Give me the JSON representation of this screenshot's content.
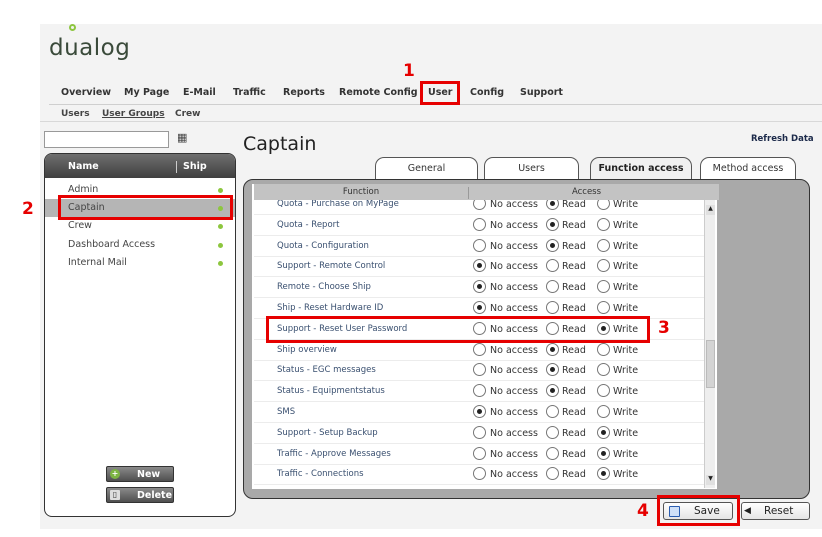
{
  "brand": {
    "logo_text": "dualog"
  },
  "top_nav": [
    {
      "label": "Overview"
    },
    {
      "label": "My Page"
    },
    {
      "label": "E-Mail"
    },
    {
      "label": "Traffic"
    },
    {
      "label": "Reports"
    },
    {
      "label": "Remote Config"
    },
    {
      "label": "User"
    },
    {
      "label": "Config"
    },
    {
      "label": "Support"
    }
  ],
  "sub_nav": [
    {
      "label": "Users"
    },
    {
      "label": "User Groups"
    },
    {
      "label": "Crew"
    }
  ],
  "left_panel": {
    "search_value": "",
    "columns": {
      "name": "Name",
      "ship": "Ship"
    },
    "groups": [
      {
        "label": "Admin"
      },
      {
        "label": "Captain"
      },
      {
        "label": "Crew"
      },
      {
        "label": "Dashboard Access"
      },
      {
        "label": "Internal Mail"
      }
    ],
    "new_label": "New",
    "delete_label": "Delete"
  },
  "page_title": "Captain",
  "refresh_label": "Refresh Data",
  "tabs": [
    {
      "label": "General"
    },
    {
      "label": "Users"
    },
    {
      "label": "Function access"
    },
    {
      "label": "Method access"
    }
  ],
  "grid": {
    "col_function": "Function",
    "col_access": "Access",
    "access_options": [
      "No access",
      "Read",
      "Write"
    ],
    "rows": [
      {
        "function": "Quota - Purchase on MyPage",
        "access": "Read"
      },
      {
        "function": "Quota - Report",
        "access": "Read"
      },
      {
        "function": "Quota - Configuration",
        "access": "Read"
      },
      {
        "function": "Support - Remote Control",
        "access": "No access"
      },
      {
        "function": "Remote - Choose Ship",
        "access": "No access"
      },
      {
        "function": "Ship - Reset Hardware ID",
        "access": "No access"
      },
      {
        "function": "Support - Reset User Password",
        "access": "Write"
      },
      {
        "function": "Ship overview",
        "access": "Read"
      },
      {
        "function": "Status - EGC messages",
        "access": "Read"
      },
      {
        "function": "Status - Equipmentstatus",
        "access": "Read"
      },
      {
        "function": "SMS",
        "access": "No access"
      },
      {
        "function": "Support - Setup Backup",
        "access": "Write"
      },
      {
        "function": "Traffic - Approve Messages",
        "access": "Write"
      },
      {
        "function": "Traffic - Connections",
        "access": "Write"
      }
    ]
  },
  "buttons": {
    "save": "Save",
    "reset": "Reset"
  },
  "annotations": [
    "1",
    "2",
    "3",
    "4"
  ],
  "colors": {
    "highlight": "#e60000",
    "status_dot": "#8dc63f"
  }
}
